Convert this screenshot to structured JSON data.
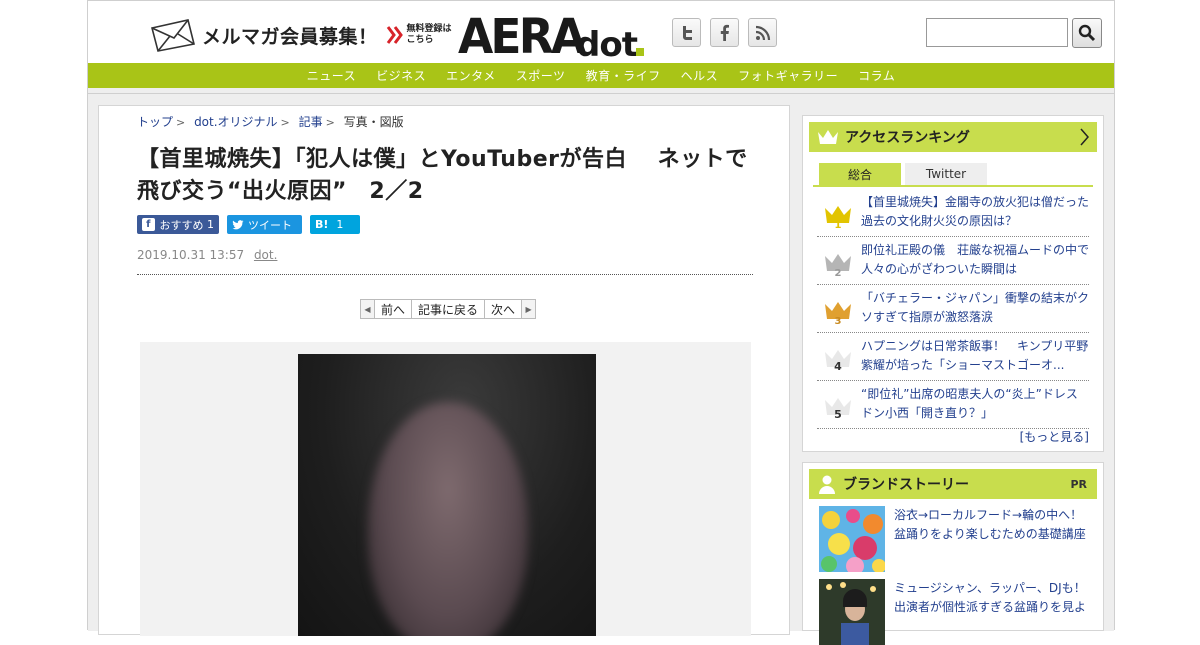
{
  "header": {
    "mailmag_title": "メルマガ会員募集！",
    "mailmag_sub": "無料登録はこちら",
    "logo": "AERAdot.",
    "social": [
      "twitter-icon",
      "facebook-icon",
      "rss-icon"
    ],
    "search_placeholder": ""
  },
  "nav": {
    "items": [
      "ニュース",
      "ビジネス",
      "エンタメ",
      "スポーツ",
      "教育・ライフ",
      "ヘルス",
      "フォトギャラリー",
      "コラム"
    ]
  },
  "article": {
    "breadcrumb": [
      "トップ",
      "dot.オリジナル",
      "記事",
      "写真・図版"
    ],
    "title": "【首里城焼失】「犯人は僕」とYouTuberが告白　 ネットで飛び交う“出火原因”　2／2",
    "share": {
      "facebook_label": "おすすめ",
      "facebook_count": "1",
      "twitter_label": "ツイート",
      "hatena_label": "B!",
      "hatena_count": "1"
    },
    "date": "2019.10.31 13:57",
    "source": "dot.",
    "pager": {
      "prev": "前へ",
      "back": "記事に戻る",
      "next": "次へ"
    }
  },
  "sidebar": {
    "ranking": {
      "title": "アクセスランキング",
      "tabs": [
        "総合",
        "Twitter"
      ],
      "items": [
        {
          "rank": "1",
          "text": "【首里城焼失】金閣寺の放火犯は僧だった　過去の文化財火災の原因は？"
        },
        {
          "rank": "2",
          "text": "即位礼正殿の儀　荘厳な祝福ムードの中で人々の心がざわついた瞬間は"
        },
        {
          "rank": "3",
          "text": "「バチェラー・ジャパン」衝撃の結末がクソすぎて指原が激怒落涙"
        },
        {
          "rank": "4",
          "text": "ハプニングは日常茶飯事！　キンプリ平野紫耀が培った「ショーマストゴーオ..."
        },
        {
          "rank": "5",
          "text": "“即位礼”出席の昭恵夫人の“炎上”ドレス　ドン小西「開き直り？」"
        }
      ],
      "more": "[もっと見る]",
      "colors": {
        "gold": "#e2c400",
        "silver": "#b5b5b5",
        "bronze": "#e0a030"
      }
    },
    "brand": {
      "title": "ブランドストーリー",
      "badge": "PR",
      "items": [
        {
          "text": "浴衣→ローカルフード→輪の中へ！盆踊りをより楽しむための基礎講座"
        },
        {
          "text": "ミュージシャン、ラッパー、DJも！出演者が個性派すぎる盆踊りを見よ"
        }
      ]
    }
  },
  "colors": {
    "accent_green": "#a9c417",
    "sidebar_green": "#c8dd4d",
    "link_blue": "#23408e"
  }
}
